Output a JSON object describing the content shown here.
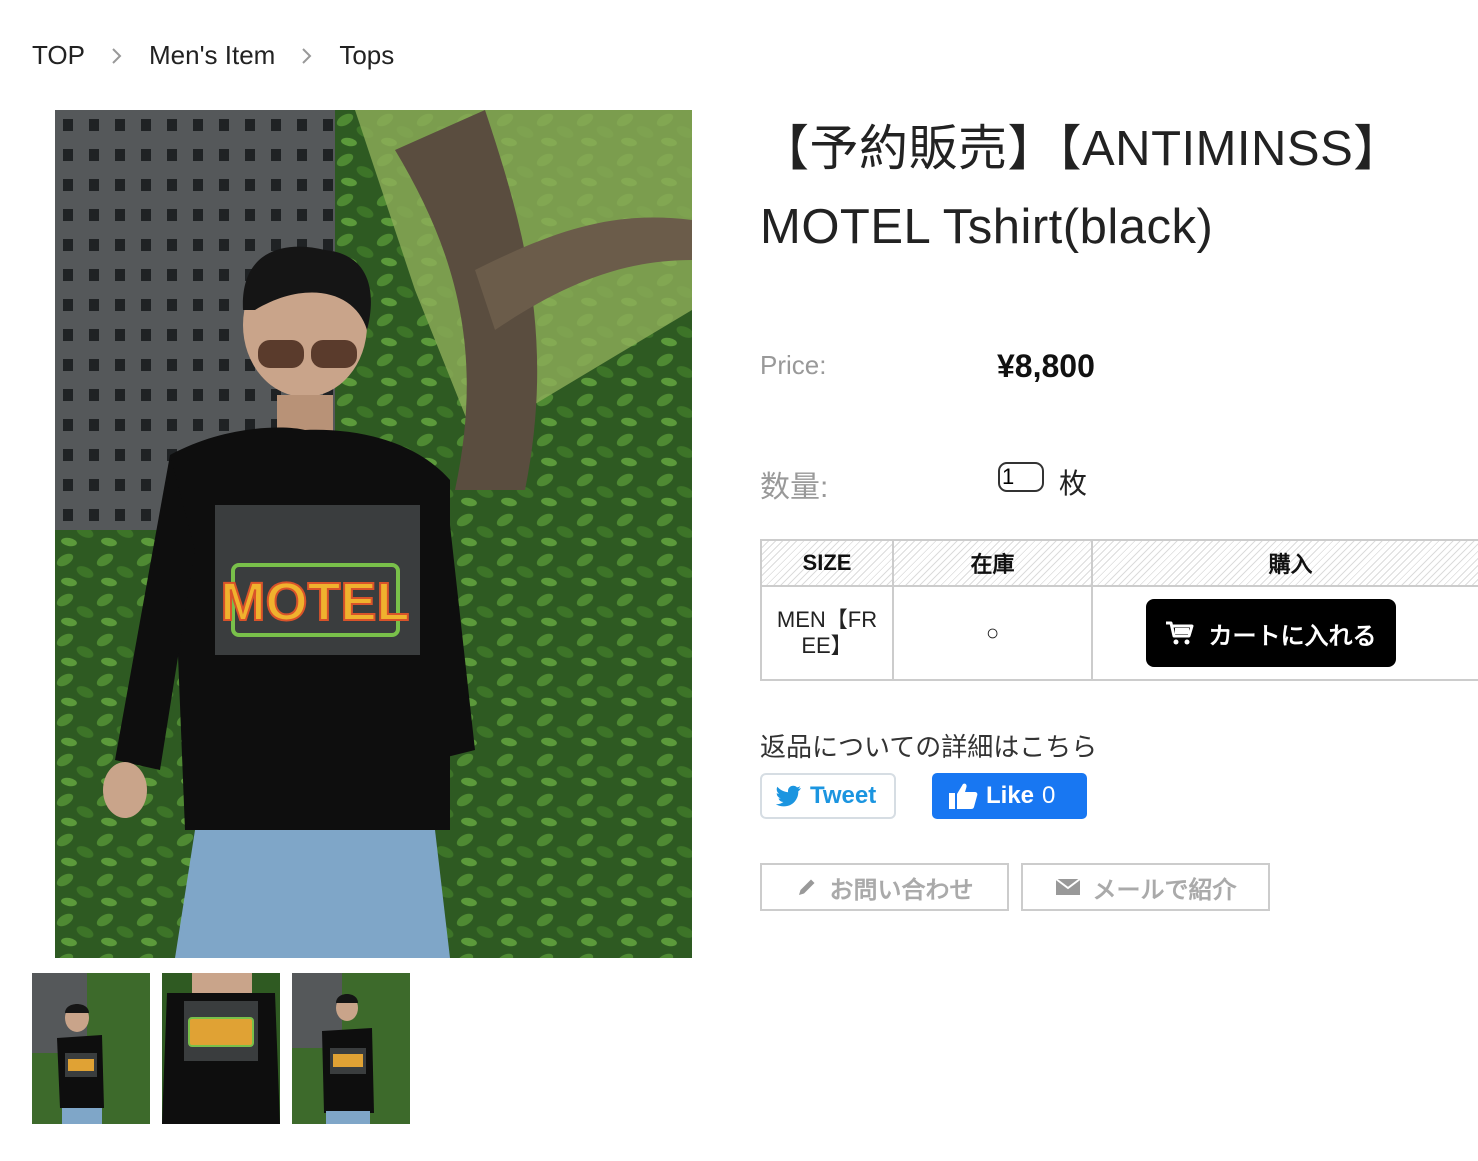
{
  "breadcrumb": {
    "items": [
      "TOP",
      "Men's Item",
      "Tops"
    ]
  },
  "product": {
    "title_line1": "【予約販売】【ANTIMINSS】",
    "title_line2": "MOTEL Tshirt(black)",
    "price_label": "Price:",
    "price": "¥8,800",
    "qty_label": "数量:",
    "qty_value": "1",
    "qty_unit": "枚"
  },
  "stock_table": {
    "headers": [
      "SIZE",
      "在庫",
      "購入"
    ],
    "rows": [
      {
        "size_line1": "MEN【FR",
        "size_line2": "EE】",
        "stock": "○",
        "cart_label": "カートに入れる"
      }
    ]
  },
  "links": {
    "return_info": "返品についての詳細はこちら"
  },
  "social": {
    "tweet_label": "Tweet",
    "like_label": "Like",
    "like_count": "0"
  },
  "actions": {
    "inquiry_label": "お問い合わせ",
    "email_label": "メールで紹介"
  },
  "images": {
    "main_photo_print": "MOTEL",
    "thumb_count": 3
  },
  "colors": {
    "cart_button": "#000000",
    "twitter_blue": "#1b95e0",
    "facebook_blue": "#1877f2",
    "muted_label": "#999999"
  }
}
